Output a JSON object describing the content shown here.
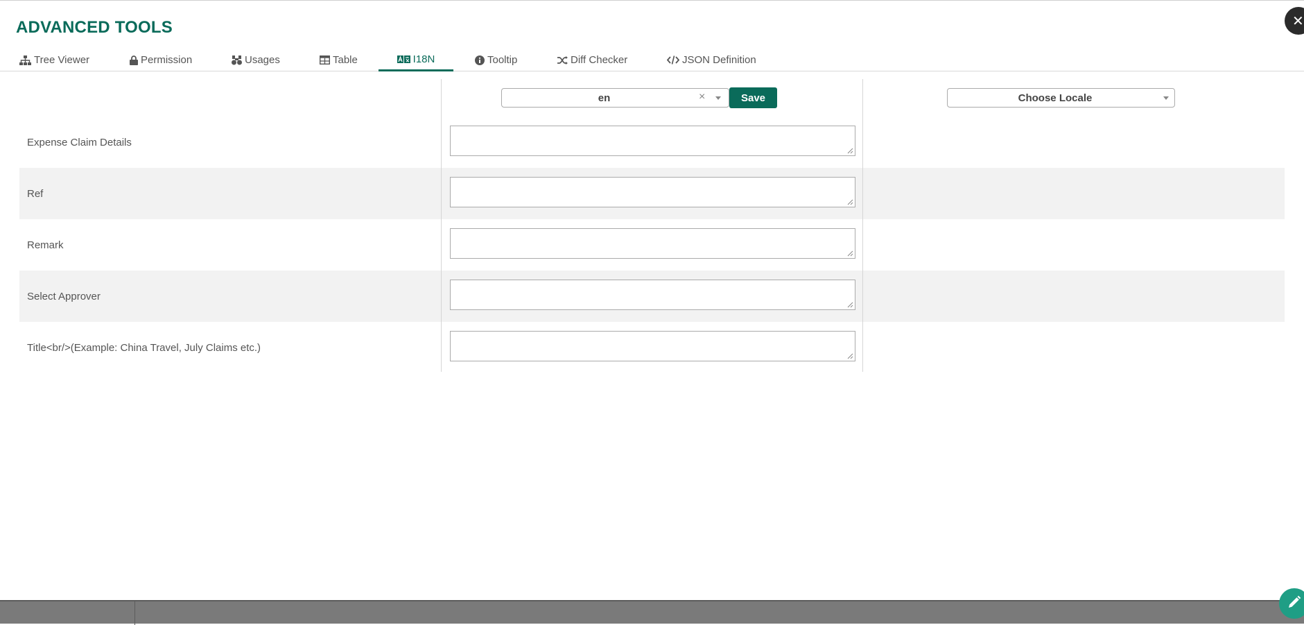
{
  "app": {
    "title": "ADVANCED TOOLS"
  },
  "close": {
    "glyph": "✕",
    "icon": "close-icon"
  },
  "tabs": [
    {
      "label": "Tree Viewer",
      "icon": "sitemap-icon"
    },
    {
      "label": "Permission",
      "icon": "lock-icon"
    },
    {
      "label": "Usages",
      "icon": "binoculars-icon"
    },
    {
      "label": "Table",
      "icon": "table-icon"
    },
    {
      "label": "I18N",
      "icon": "language-icon",
      "active": true
    },
    {
      "label": "Tooltip",
      "icon": "info-circle-icon"
    },
    {
      "label": "Diff Checker",
      "icon": "random-icon"
    },
    {
      "label": "JSON Definition",
      "icon": "code-icon"
    }
  ],
  "locale": {
    "selected": "en",
    "clear_glyph": "×",
    "save_label": "Save",
    "compare_placeholder": "Choose Locale"
  },
  "rows": [
    {
      "label": "Expense Claim Details",
      "value": ""
    },
    {
      "label": "Ref",
      "value": ""
    },
    {
      "label": "Remark",
      "value": ""
    },
    {
      "label": "Select Approver",
      "value": ""
    },
    {
      "label": "Title<br/>(Example: China Travel, July Claims etc.)",
      "value": ""
    }
  ],
  "colors": {
    "accent": "#0a6b5a",
    "fab": "#1f9e85",
    "footer": "#7a7a7a"
  }
}
